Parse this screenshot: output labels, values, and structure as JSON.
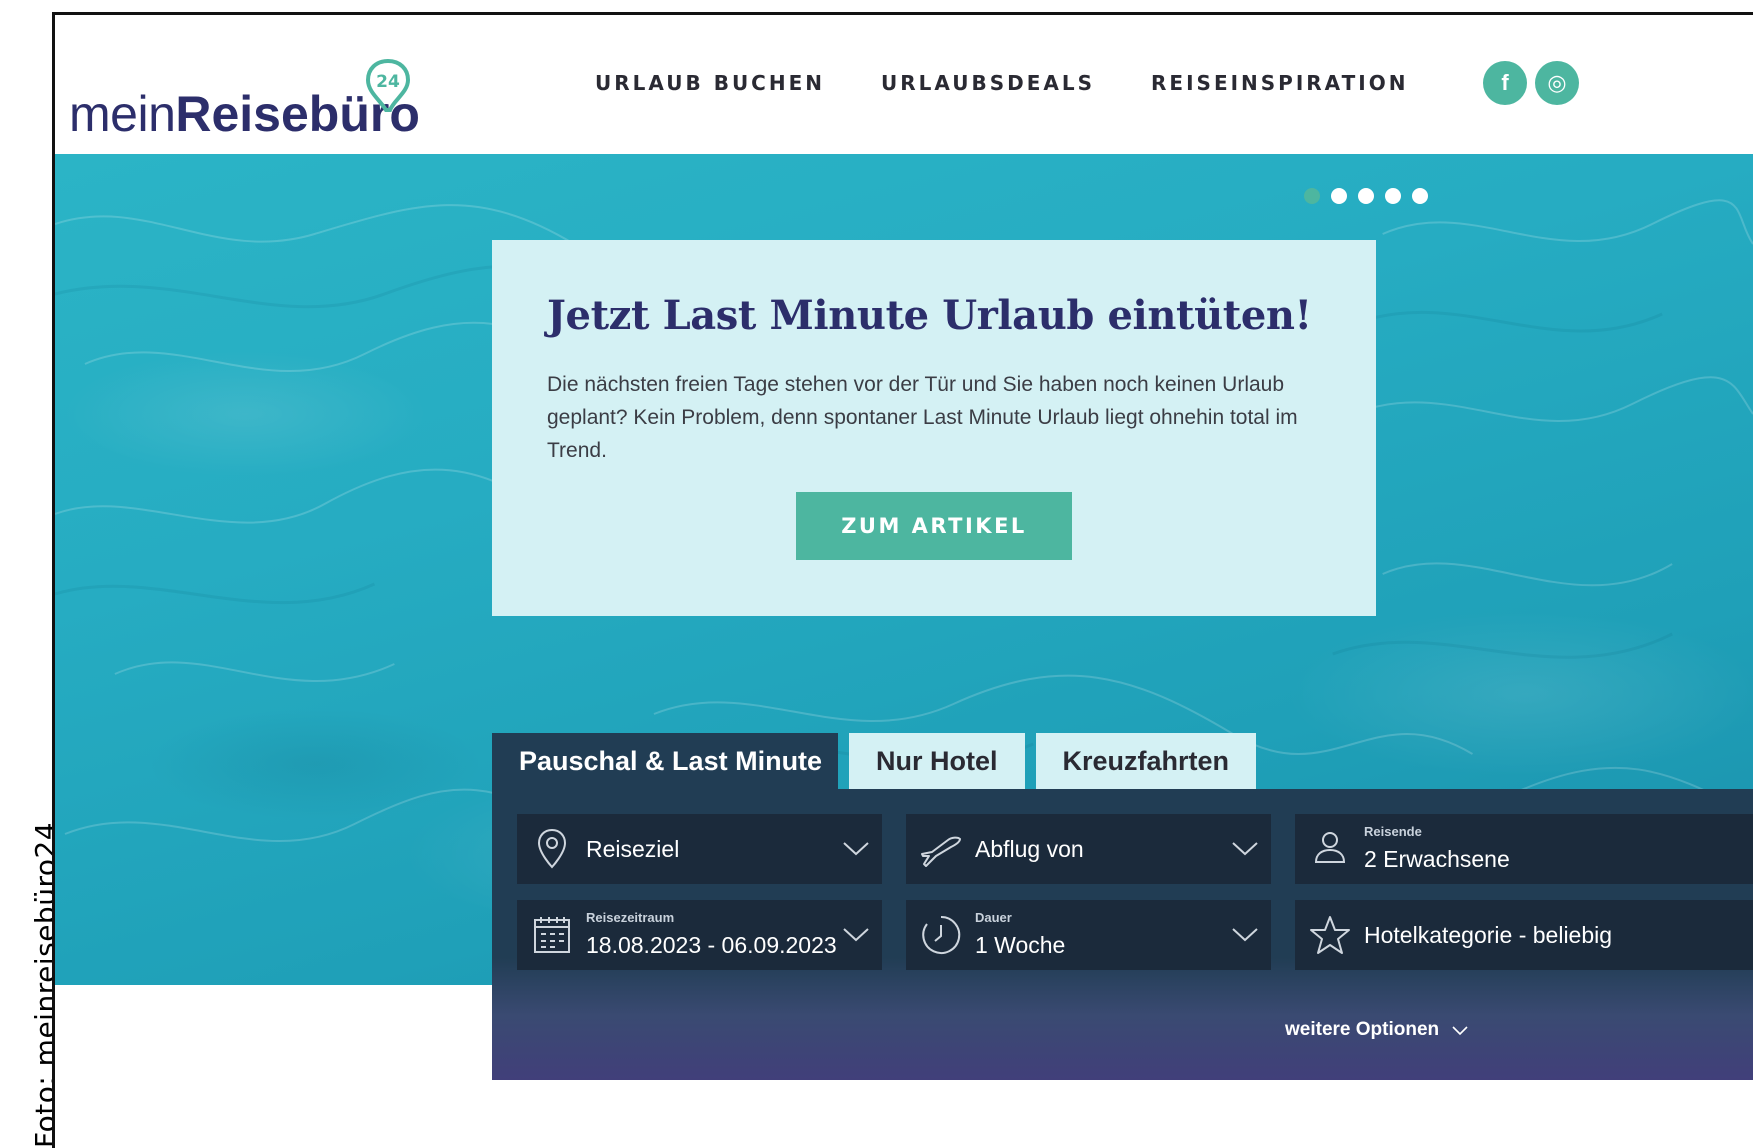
{
  "credit": "Foto: meinreisebüro24",
  "logo": {
    "light": "mein",
    "bold": "Reisebüro",
    "badge": "24"
  },
  "nav": [
    {
      "label": "URLAUB BUCHEN"
    },
    {
      "label": "URLAUBSDEALS"
    },
    {
      "label": "REISEINSPIRATION"
    }
  ],
  "social": [
    {
      "icon": "facebook-icon",
      "glyph": "f"
    },
    {
      "icon": "instagram-icon",
      "glyph": "◎"
    }
  ],
  "carousel": {
    "count": 5,
    "active_index": 0
  },
  "promo": {
    "title": "Jetzt Last Minute Urlaub eintüten!",
    "text": "Die nächsten freien Tage stehen vor der Tür und Sie haben noch keinen Urlaub geplant? Kein Problem, denn spontaner Last Minute Urlaub liegt ohnehin total im Trend.",
    "button": "ZUM ARTIKEL"
  },
  "tabs": [
    {
      "label": "Pauschal & Last Minute",
      "active": true
    },
    {
      "label": "Nur Hotel",
      "active": false
    },
    {
      "label": "Kreuzfahrten",
      "active": false
    }
  ],
  "search": {
    "destination": {
      "value": "Reiseziel",
      "icon": "map-pin-icon"
    },
    "departure": {
      "value": "Abflug von",
      "icon": "airplane-icon"
    },
    "travelers": {
      "label": "Reisende",
      "value": "2 Erwachsene",
      "icon": "person-icon"
    },
    "period": {
      "label": "Reisezeitraum",
      "value": "18.08.2023 - 06.09.2023",
      "icon": "calendar-icon"
    },
    "duration": {
      "label": "Dauer",
      "value": "1 Woche",
      "icon": "clock-icon"
    },
    "hotel_category": {
      "value": "Hotelkategorie - beliebig",
      "icon": "star-icon"
    },
    "more_options": "weitere Optionen"
  },
  "colors": {
    "brand_navy": "#2c2e6b",
    "brand_teal": "#4db6a0",
    "panel_dark": "#213d54",
    "field_dark": "#1b2a3b",
    "promo_bg": "#d4f1f4",
    "water": "#26acc2"
  }
}
